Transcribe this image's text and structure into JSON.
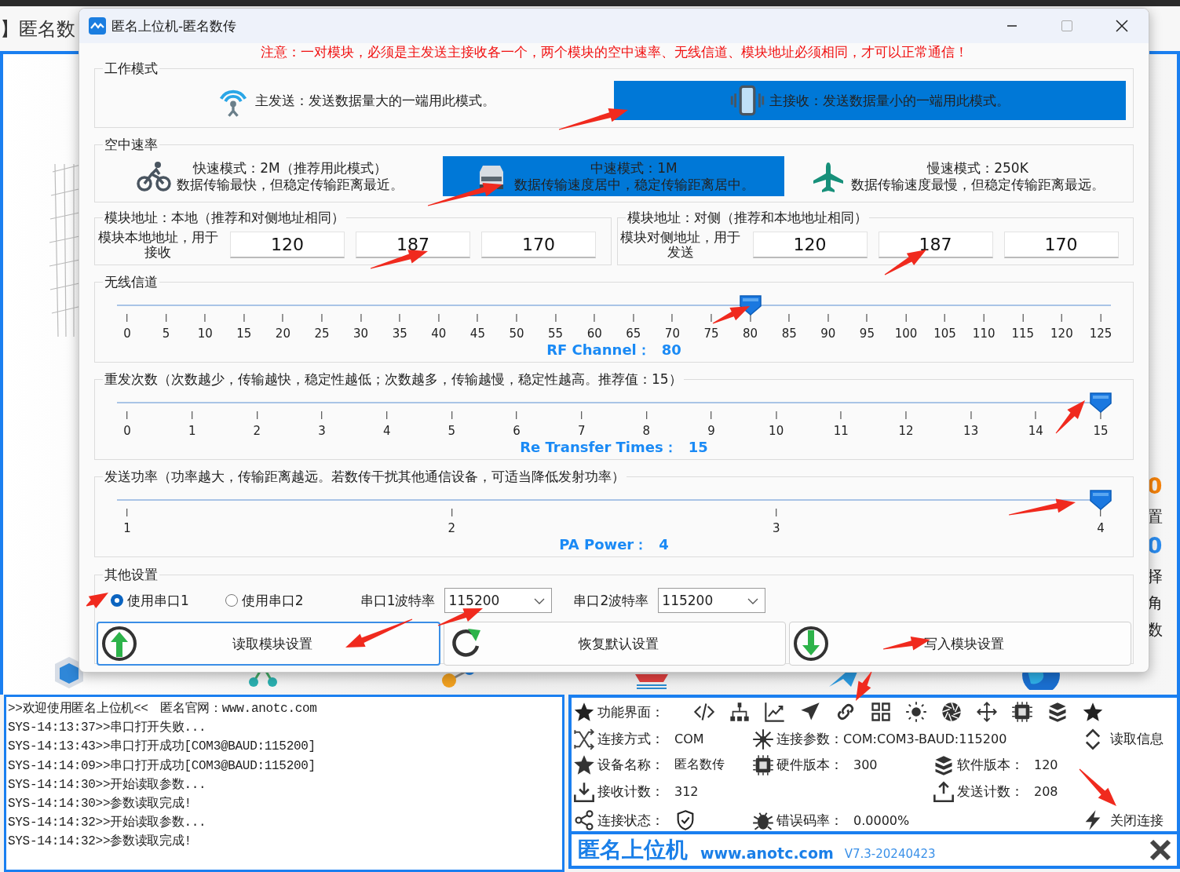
{
  "app": {
    "title_fragment": "】匿名数",
    "side_fragments": [
      {
        "text": "0",
        "color": "#f5820a"
      },
      {
        "text": "置",
        "color": "#222222"
      },
      {
        "text": "0",
        "color": "#2a8cf0"
      },
      {
        "text": "择",
        "color": "#222222"
      },
      {
        "text": "角",
        "color": "#222222"
      },
      {
        "text": "数",
        "color": "#222222"
      }
    ]
  },
  "log": [
    ">>欢迎使用匿名上位机<<　匿名官网：www.anotc.com",
    "SYS-14:13:37>>串口打开失败...",
    "SYS-14:13:43>>串口打开成功[COM3@BAUD:115200]",
    "SYS-14:14:09>>串口打开成功[COM3@BAUD:115200]",
    "SYS-14:14:30>>开始读取参数...",
    "SYS-14:14:30>>参数读取完成!",
    "SYS-14:14:32>>开始读取参数...",
    "SYS-14:14:32>>参数读取完成!"
  ],
  "info_panel": {
    "functions_label": "功能界面：",
    "fields": [
      {
        "label": "连接方式：",
        "value": "COM"
      },
      {
        "label": "连接参数：",
        "value": "COM:COM3-BAUD:115200"
      },
      {
        "label": "设备名称：",
        "value": "匿名数传"
      },
      {
        "label": "硬件版本：",
        "value": "300"
      },
      {
        "label": "软件版本：",
        "value": "120"
      },
      {
        "label": "接收计数：",
        "value": "312"
      },
      {
        "label": "发送计数：",
        "value": "208"
      },
      {
        "label": "连接状态：",
        "connected": true
      },
      {
        "label": "错误码率：",
        "value": "0.0000%"
      }
    ],
    "actions": [
      "读取信息",
      "关闭连接"
    ]
  },
  "footer": {
    "brand": "匿名上位机",
    "url": "www.anotc.com",
    "version": "V7.3-20240423"
  },
  "dialog": {
    "title": "匿名上位机-匿名数传",
    "notice": "注意：一对模块，必须是主发送主接收各一个，两个模块的空中速率、无线信道、模块地址必须相同，才可以正常通信！",
    "work_mode": {
      "label": "工作模式",
      "options": [
        {
          "text": "主发送：发送数据量大的一端用此模式。",
          "selected": false
        },
        {
          "text": "主接收：发送数据量小的一端用此模式。",
          "selected": true
        }
      ]
    },
    "air_rate": {
      "label": "空中速率",
      "options": [
        {
          "lines": [
            "快速模式：2M（推荐用此模式）",
            "数据传输最快，但稳定传输距离最近。"
          ],
          "selected": false
        },
        {
          "lines": [
            "中速模式：1M",
            "数据传输速度居中，稳定传输距离居中。"
          ],
          "selected": true
        },
        {
          "lines": [
            "慢速模式：250K",
            "数据传输速度最慢，但稳定传输距离最远。"
          ],
          "selected": false
        }
      ]
    },
    "addresses": [
      {
        "label": "模块地址：本地（推荐和对侧地址相同）",
        "caption": "模块本地地址，用于接收",
        "values": [
          "120",
          "187",
          "170"
        ]
      },
      {
        "label": "模块地址：对侧（推荐和本地地址相同）",
        "caption": "模块对侧地址，用于发送",
        "values": [
          "120",
          "187",
          "170"
        ]
      }
    ],
    "sliders": [
      {
        "label": "无线信道",
        "ticks": [
          "0",
          "5",
          "10",
          "15",
          "20",
          "25",
          "30",
          "35",
          "40",
          "45",
          "50",
          "55",
          "60",
          "65",
          "70",
          "75",
          "80",
          "85",
          "90",
          "95",
          "100",
          "105",
          "110",
          "115",
          "120",
          "125"
        ],
        "level": 0.64,
        "reading_label": "RF Channel：",
        "reading": "80"
      },
      {
        "label": "重发次数（次数越少，传输越快，稳定性越低；次数越多，传输越慢，稳定性越高。推荐值：15）",
        "ticks": [
          "0",
          "1",
          "2",
          "3",
          "4",
          "5",
          "6",
          "7",
          "8",
          "9",
          "10",
          "11",
          "12",
          "13",
          "14",
          "15"
        ],
        "level": 1,
        "reading_label": "Re Transfer Times：",
        "reading": "15"
      },
      {
        "label": "发送功率（功率越大，传输距离越远。若数传干扰其他通信设备，可适当降低发射功率）",
        "ticks": [
          "1",
          "2",
          "3",
          "4"
        ],
        "level": 1,
        "reading_label": "PA Power：",
        "reading": "4"
      }
    ],
    "other": {
      "label": "其他设置",
      "ports": [
        {
          "label": "使用串口1",
          "selected": true
        },
        {
          "label": "使用串口2",
          "selected": false
        }
      ],
      "bauds": [
        {
          "label": "串口1波特率",
          "value": "115200"
        },
        {
          "label": "串口2波特率",
          "value": "115200"
        }
      ],
      "buttons": [
        {
          "label": "读取模块设置",
          "focused": true
        },
        {
          "label": "恢复默认设置",
          "focused": false
        },
        {
          "label": "写入模块设置",
          "focused": false
        }
      ]
    }
  }
}
